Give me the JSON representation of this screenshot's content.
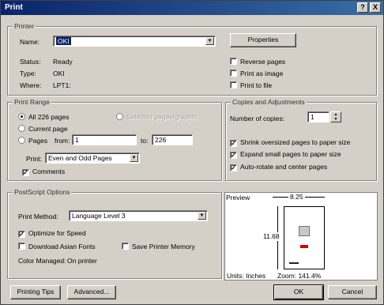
{
  "window": {
    "title": "Print",
    "help_glyph": "?",
    "close_glyph": "X"
  },
  "printer": {
    "group_title": "Printer",
    "name_label": "Name:",
    "name_value": "OKI",
    "properties_button": "Properties",
    "status_label": "Status:",
    "status_value": "Ready",
    "type_label": "Type:",
    "type_value": "OKI",
    "where_label": "Where:",
    "where_value": "LPT1:",
    "reverse_pages": "Reverse pages",
    "print_as_image": "Print as image",
    "print_to_file": "Print to file"
  },
  "print_range": {
    "group_title": "Print Range",
    "all_pages": "All 226 pages",
    "selected_graphic": "Selected pages/graphic",
    "current_page": "Current page",
    "pages_label": "Pages",
    "from_label": "from:",
    "from_value": "1",
    "to_label": "to:",
    "to_value": "226",
    "print_label": "Print:",
    "print_value": "Even and Odd Pages",
    "comments": "Comments"
  },
  "copies": {
    "group_title": "Copies and Adjustments",
    "number_label": "Number of copies:",
    "number_value": "1",
    "shrink": "Shrink oversized pages to paper size",
    "expand": "Expand small pages to paper size",
    "autorotate": "Auto-rotate and center pages"
  },
  "postscript": {
    "group_title": "PostScript Options",
    "method_label": "Print Method:",
    "method_value": "Language Level 3",
    "optimize": "Optimize for Speed",
    "download_fonts": "Download Asian Fonts",
    "save_memory": "Save Printer Memory",
    "color_managed_label": "Color Managed:",
    "color_managed_value": "On printer"
  },
  "preview": {
    "title": "Preview",
    "width_label": "8.25",
    "height_label": "11.68",
    "units_label": "Units: Inches",
    "zoom_label": "Zoom: 141.4%"
  },
  "buttons": {
    "printing_tips": "Printing Tips",
    "advanced": "Advanced...",
    "ok": "OK",
    "cancel": "Cancel"
  },
  "colors": {
    "titlebar": "#0a246a",
    "face": "#d4d0c8",
    "preview_accent": "#cc0000"
  }
}
